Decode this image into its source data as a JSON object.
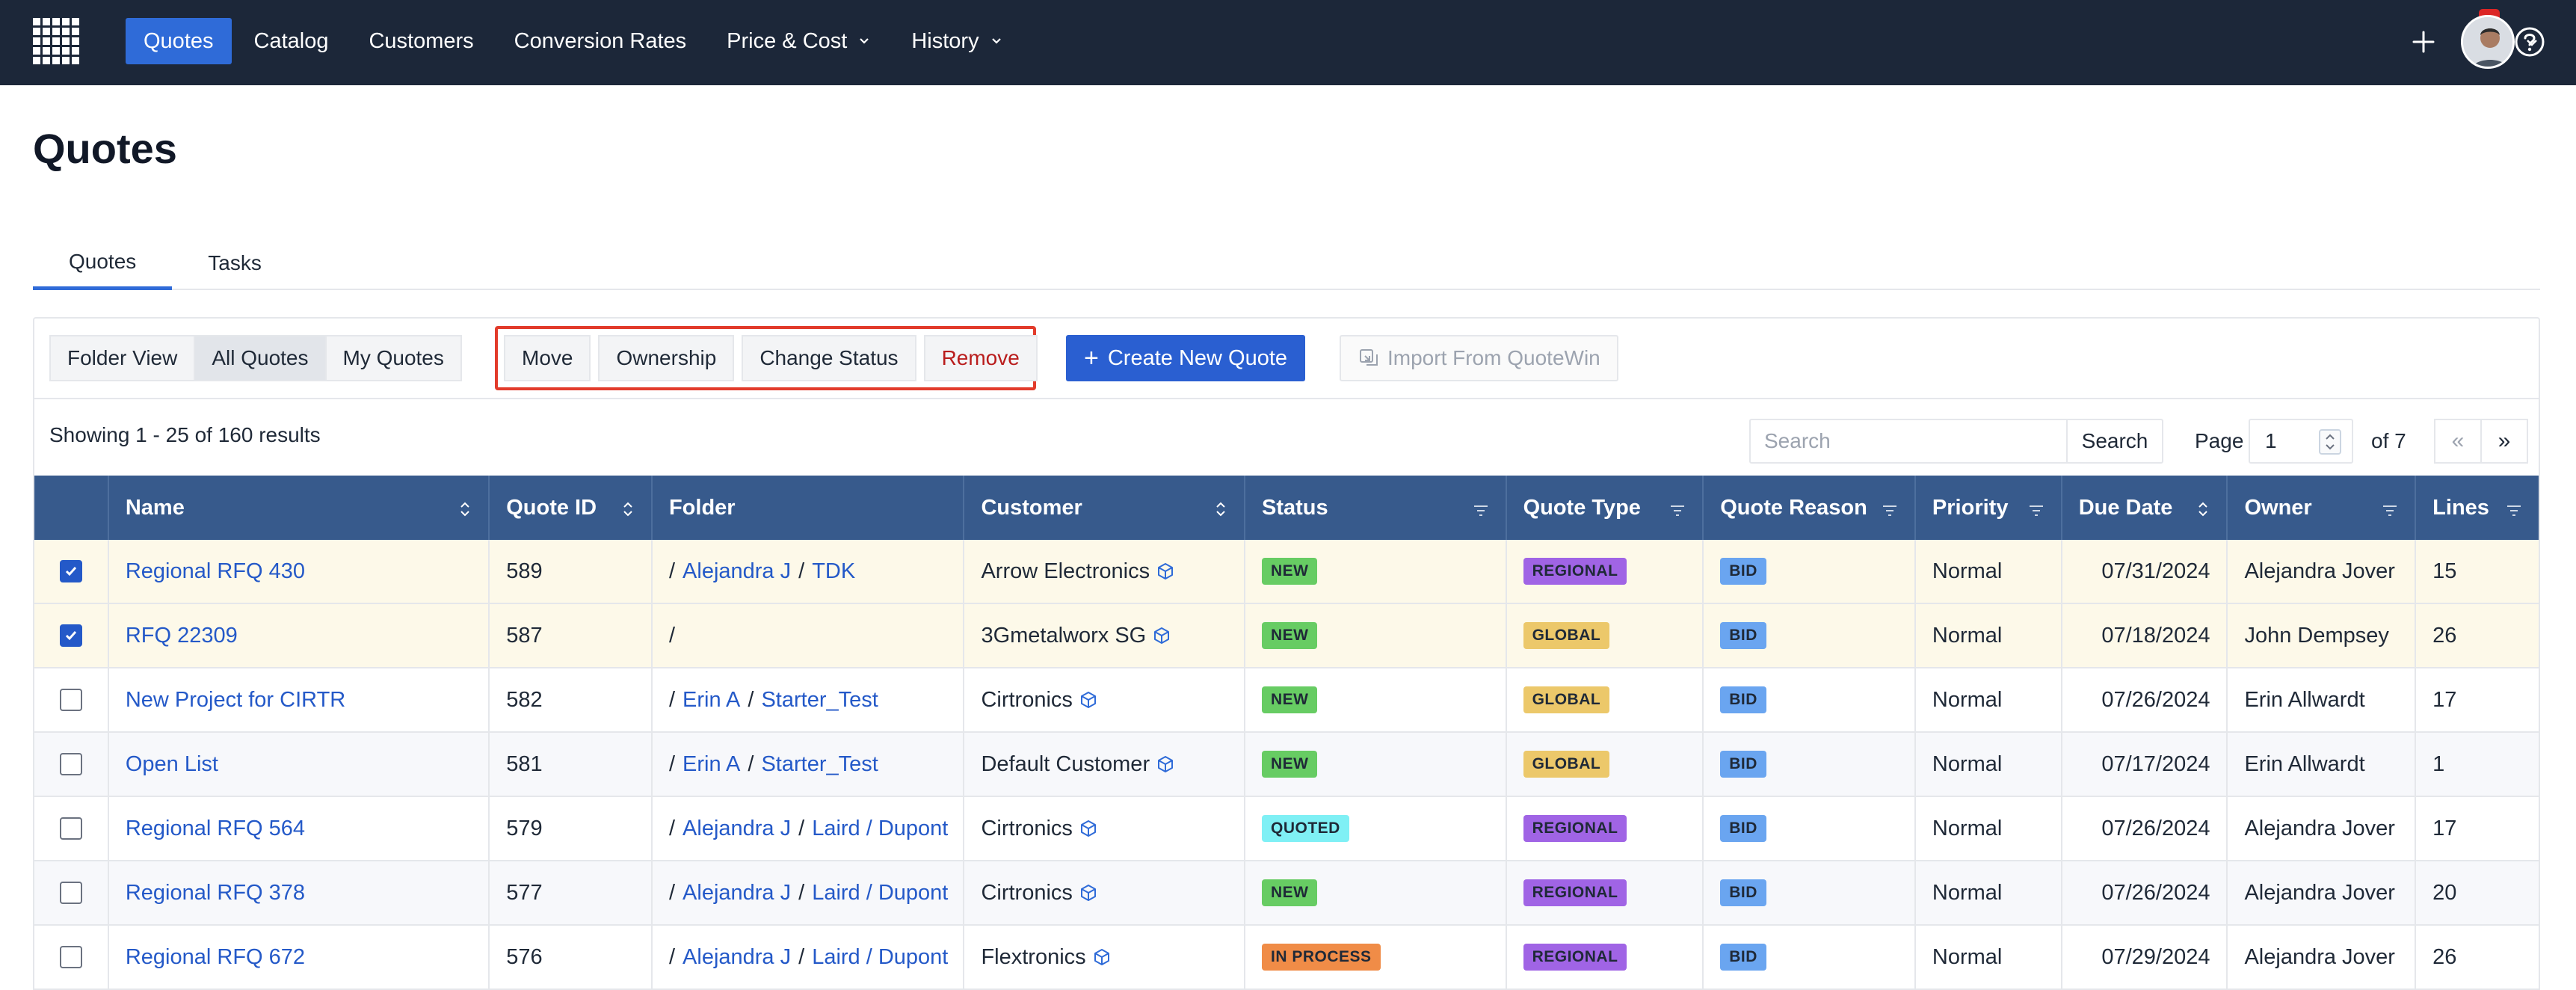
{
  "nav": {
    "items": [
      {
        "label": "Quotes",
        "active": true
      },
      {
        "label": "Catalog"
      },
      {
        "label": "Customers"
      },
      {
        "label": "Conversion Rates"
      },
      {
        "label": "Price & Cost",
        "dropdown": true
      },
      {
        "label": "History",
        "dropdown": true
      }
    ],
    "notification_count": "1",
    "icons": [
      "grid-logo-icon",
      "plus-icon",
      "bell-icon",
      "help-icon",
      "avatar",
      "chevron-down-icon"
    ]
  },
  "page": {
    "title": "Quotes"
  },
  "tabs": [
    {
      "label": "Quotes",
      "active": true
    },
    {
      "label": "Tasks"
    }
  ],
  "toolbar": {
    "views": [
      {
        "label": "Folder View"
      },
      {
        "label": "All Quotes",
        "selected": true
      },
      {
        "label": "My Quotes"
      }
    ],
    "actions": [
      {
        "label": "Move"
      },
      {
        "label": "Ownership"
      },
      {
        "label": "Change Status"
      },
      {
        "label": "Remove"
      }
    ],
    "create_label": "Create New Quote",
    "import_label": "Import From QuoteWin"
  },
  "results": {
    "summary": "Showing 1 - 25 of 160 results",
    "search_placeholder": "Search",
    "search_button": "Search",
    "page_label": "Page",
    "page_value": "1",
    "page_of": "of 7",
    "prev": "«",
    "next": "»"
  },
  "colors": {
    "nav_bg": "#1c2739",
    "accent": "#2f6bd8",
    "header_bg": "#375a8c",
    "highlight": "#e23b2b",
    "status_new": "#67cc63",
    "status_quoted": "#7ff0f5",
    "status_in_process": "#f08c47",
    "type_regional": "#a064e5",
    "type_global": "#ecc86a",
    "reason_bid": "#6aa5f0"
  },
  "table": {
    "headers": [
      "Name",
      "Quote ID",
      "Folder",
      "Customer",
      "Status",
      "Quote Type",
      "Quote Reason",
      "Priority",
      "Due Date",
      "Owner",
      "Lines"
    ],
    "rows": [
      {
        "checked": true,
        "name": "Regional RFQ 430",
        "id": "589",
        "folder": [
          "Alejandra J",
          "TDK"
        ],
        "customer": "Arrow Electronics",
        "status": "NEW",
        "status_kind": "new",
        "type": "REGIONAL",
        "type_kind": "regional",
        "reason": "BID",
        "priority": "Normal",
        "due": "07/31/2024",
        "owner": "Alejandra Jover",
        "lines": "15"
      },
      {
        "checked": true,
        "name": "RFQ 22309",
        "id": "587",
        "folder": [],
        "customer": "3Gmetalworx SG",
        "status": "NEW",
        "status_kind": "new",
        "type": "GLOBAL",
        "type_kind": "global",
        "reason": "BID",
        "priority": "Normal",
        "due": "07/18/2024",
        "owner": "John Dempsey",
        "lines": "26"
      },
      {
        "checked": false,
        "name": "New Project for CIRTR",
        "id": "582",
        "folder": [
          "Erin A",
          "Starter_Test"
        ],
        "customer": "Cirtronics",
        "status": "NEW",
        "status_kind": "new",
        "type": "GLOBAL",
        "type_kind": "global",
        "reason": "BID",
        "priority": "Normal",
        "due": "07/26/2024",
        "owner": "Erin Allwardt",
        "lines": "17"
      },
      {
        "checked": false,
        "name": "Open List",
        "id": "581",
        "folder": [
          "Erin A",
          "Starter_Test"
        ],
        "customer": "Default Customer",
        "status": "NEW",
        "status_kind": "new",
        "type": "GLOBAL",
        "type_kind": "global",
        "reason": "BID",
        "priority": "Normal",
        "due": "07/17/2024",
        "owner": "Erin Allwardt",
        "lines": "1"
      },
      {
        "checked": false,
        "name": "Regional RFQ 564",
        "id": "579",
        "folder": [
          "Alejandra J",
          "Laird / Dupont"
        ],
        "customer": "Cirtronics",
        "status": "QUOTED",
        "status_kind": "quoted",
        "type": "REGIONAL",
        "type_kind": "regional",
        "reason": "BID",
        "priority": "Normal",
        "due": "07/26/2024",
        "owner": "Alejandra Jover",
        "lines": "17"
      },
      {
        "checked": false,
        "name": "Regional RFQ 378",
        "id": "577",
        "folder": [
          "Alejandra J",
          "Laird / Dupont"
        ],
        "customer": "Cirtronics",
        "status": "NEW",
        "status_kind": "new",
        "type": "REGIONAL",
        "type_kind": "regional",
        "reason": "BID",
        "priority": "Normal",
        "due": "07/26/2024",
        "owner": "Alejandra Jover",
        "lines": "20"
      },
      {
        "checked": false,
        "name": "Regional RFQ 672",
        "id": "576",
        "folder": [
          "Alejandra J",
          "Laird / Dupont"
        ],
        "customer": "Flextronics",
        "status": "IN PROCESS",
        "status_kind": "in_process",
        "type": "REGIONAL",
        "type_kind": "regional",
        "reason": "BID",
        "priority": "Normal",
        "due": "07/29/2024",
        "owner": "Alejandra Jover",
        "lines": "26"
      }
    ]
  }
}
